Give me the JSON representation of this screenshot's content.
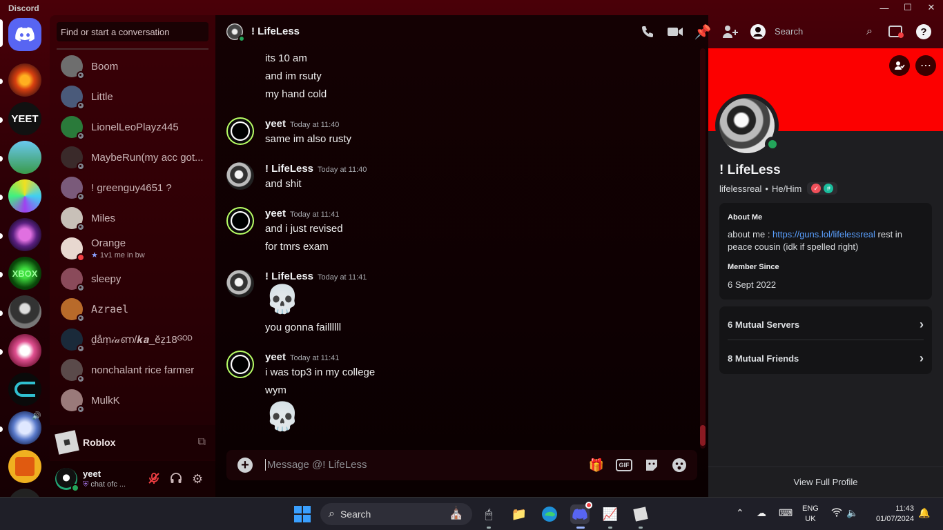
{
  "app": {
    "title": "Discord",
    "window_controls": [
      "—",
      "☐",
      "✕"
    ]
  },
  "dm_sidebar": {
    "search_placeholder": "Find or start a conversation",
    "items": [
      {
        "name": "Boom",
        "status": "offline",
        "color": "#6e6e6e"
      },
      {
        "name": "Little",
        "status": "offline",
        "color": "#4a5a7a"
      },
      {
        "name": "LionelLeoPlayz445",
        "status": "offline",
        "color": "#2a7a3a"
      },
      {
        "name": "MaybeRun(my acc got...",
        "status": "offline",
        "color": "#3a2a2a"
      },
      {
        "name": "! greenguy4651 ?",
        "status": "offline",
        "color": "#7a5a7a"
      },
      {
        "name": "Miles",
        "status": "offline",
        "color": "#c8c0b8"
      },
      {
        "name": "Orange",
        "status": "dnd",
        "sub": "1v1 me in bw",
        "color": "#e8d8d0"
      },
      {
        "name": "sleepy",
        "status": "offline",
        "color": "#8a4a5a"
      },
      {
        "name": "Azrael",
        "status": "offline",
        "color": "#b86a2a"
      },
      {
        "name": "ḓåṃ𝒾𝒶ണ/𝒌𝒂_ěẕ18ᴳᴼᴰ",
        "status": "offline",
        "color": "#1a2a3a"
      },
      {
        "name": "nonchalant rice farmer",
        "status": "offline",
        "color": "#5a4a4a"
      },
      {
        "name": "MulkK",
        "status": "offline",
        "color": "#9a7a7a"
      }
    ],
    "activity": {
      "name": "Roblox"
    },
    "user": {
      "name": "yeet",
      "custom_status": "chat ofc ..."
    }
  },
  "chat": {
    "channel_name": "! LifeLess",
    "search_label": "Search",
    "composer_placeholder": "Message @! LifeLess",
    "gif_label": "GIF",
    "messages": {
      "m0": {
        "lines": [
          "its 10 am",
          "and im rsuty",
          "my hand cold"
        ]
      },
      "m1": {
        "author": "yeet",
        "time": "Today at 11:40",
        "lines": [
          "same im also rusty"
        ]
      },
      "m2": {
        "author": "! LifeLess",
        "time": "Today at 11:40",
        "lines": [
          "and shit"
        ]
      },
      "m3": {
        "author": "yeet",
        "time": "Today at 11:41",
        "lines": [
          "and i just revised",
          "for tmrs exam"
        ]
      },
      "m4": {
        "author": "! LifeLess",
        "time": "Today at 11:41",
        "emoji": "💀",
        "lines": [
          "you gonna faillllll"
        ]
      },
      "m5": {
        "author": "yeet",
        "time": "Today at 11:41",
        "lines": [
          "i was top3 in my college",
          "wym"
        ],
        "emoji": "💀"
      }
    }
  },
  "profile": {
    "display_name": "! LifeLess",
    "username": "lifelessreal",
    "pronouns": "He/Him",
    "separator": "•",
    "about_header": "About Me",
    "about_prefix": "about me : ",
    "about_link": "https://guns.lol/lifelessreal",
    "about_suffix": " rest in peace cousin (idk if spelled right)",
    "member_since_header": "Member Since",
    "member_since": "6 Sept 2022",
    "mutual_servers": "6 Mutual Servers",
    "mutual_friends": "8 Mutual Friends",
    "view_full_profile": "View Full Profile",
    "banner_color": "#fc0000"
  },
  "taskbar": {
    "search_label": "Search",
    "lang_line1": "ENG",
    "lang_line2": "UK",
    "time": "11:43",
    "date": "01/07/2024"
  }
}
